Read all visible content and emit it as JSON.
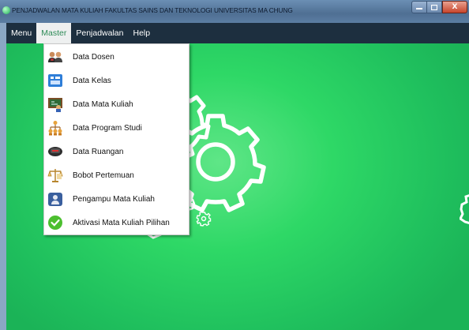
{
  "window": {
    "title": "PENJADWALAN MATA KULIAH FAKULTAS SAINS DAN TEKNOLOGI UNIVERSITAS MA CHUNG",
    "close_glyph": "X"
  },
  "menubar": {
    "items": [
      {
        "label": "Menu",
        "selected": false
      },
      {
        "label": "Master",
        "selected": true
      },
      {
        "label": "Penjadwalan",
        "selected": false
      },
      {
        "label": "Help",
        "selected": false
      }
    ]
  },
  "master_menu": {
    "items": [
      {
        "label": "Data Dosen",
        "icon": "people-icon"
      },
      {
        "label": "Data Kelas",
        "icon": "class-board-icon"
      },
      {
        "label": "Data Mata Kuliah",
        "icon": "chalkboard-icon"
      },
      {
        "label": "Data Program Studi",
        "icon": "org-chart-icon"
      },
      {
        "label": "Data Ruangan",
        "icon": "room-icon"
      },
      {
        "label": "Bobot Pertemuan",
        "icon": "scale-icon"
      },
      {
        "label": "Pengampu Mata Kuliah",
        "icon": "teacher-icon"
      },
      {
        "label": "Aktivasi Mata Kuliah Pilihan",
        "icon": "check-circle-icon"
      }
    ]
  },
  "colors": {
    "menubar_bg": "#1d2f3f",
    "menu_selected_text": "#2e8b57",
    "background_green": "#2ed866",
    "titlebar": "#5c7ea3"
  }
}
